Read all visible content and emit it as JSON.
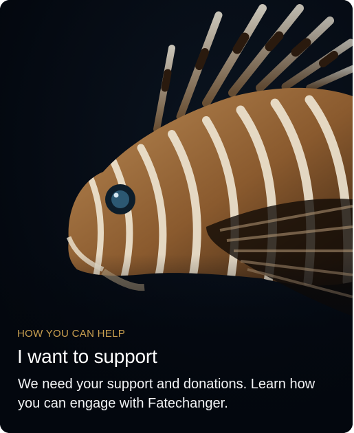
{
  "card": {
    "eyebrow": "HOW YOU CAN HELP",
    "title": "I want to support",
    "description": "We need your support and donations. Learn how you can engage with Fatechanger."
  },
  "image": {
    "subject": "lionfish-photo"
  },
  "colors": {
    "background": "#03070e",
    "eyebrow": "#caa050",
    "title": "#ffffff",
    "description": "#f1f3f5"
  }
}
